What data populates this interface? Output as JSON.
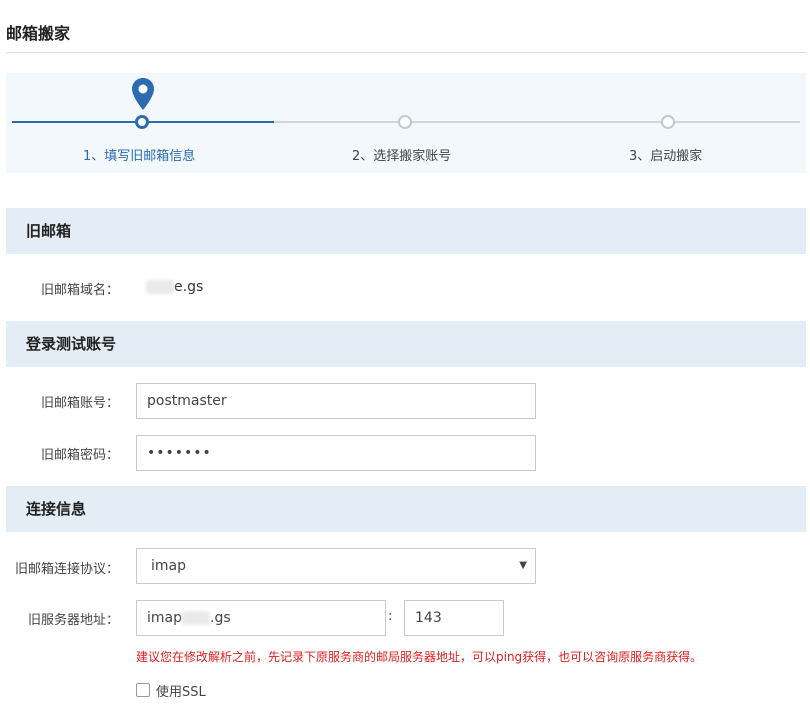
{
  "page": {
    "title": "邮箱搬家"
  },
  "steps": [
    {
      "label": "1、填写旧邮箱信息",
      "state": "active"
    },
    {
      "label": "2、选择搬家账号",
      "state": "pending"
    },
    {
      "label": "3、启动搬家",
      "state": "pending"
    }
  ],
  "sections": {
    "old_mailbox": "旧邮箱",
    "login_test": "登录测试账号",
    "connection": "连接信息"
  },
  "old_mailbox": {
    "domain_label": "旧邮箱域名：",
    "domain_suffix": "e.gs"
  },
  "login": {
    "account_label": "旧邮箱账号：",
    "account_value": "postmaster",
    "password_label": "旧邮箱密码：",
    "password_value": "•••••••"
  },
  "connection": {
    "protocol_label": "旧邮箱连接协议：",
    "protocol_value": "imap",
    "server_label": "旧服务器地址：",
    "server_prefix": "imap",
    "server_suffix": ".gs",
    "port_separator": ":",
    "port_value": "143",
    "warning": "建议您在修改解析之前，先记录下原服务商的邮局服务器地址，可以ping获得，也可以咨询原服务商获得。",
    "ssl_label": "使用SSL",
    "ssl_checked": false
  },
  "colors": {
    "accent": "#2b6cb0",
    "section_bg": "#e4edf6",
    "warning": "#e02020"
  }
}
